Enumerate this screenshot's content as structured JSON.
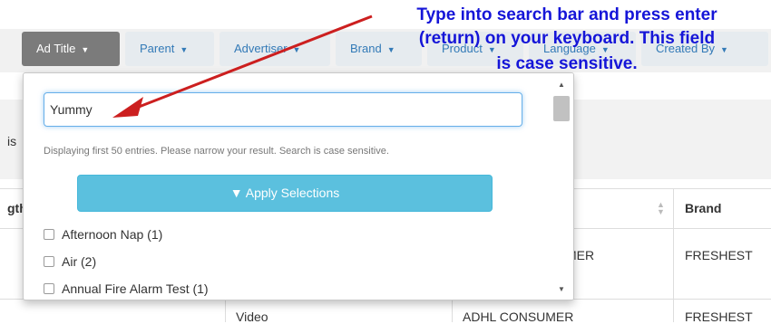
{
  "filters": {
    "ad_title": "Ad Title",
    "parent": "Parent",
    "advertiser": "Advertiser",
    "brand": "Brand",
    "product": "Product",
    "language": "Language",
    "created_by": "Created By"
  },
  "table": {
    "partial_header_1": "is",
    "partial_header_2": "gth",
    "brand_header": "Brand",
    "row1": {
      "company": "MER",
      "brand": "FRESHEST"
    },
    "row2": {
      "type": "Video",
      "company": "ADHL CONSUMER",
      "brand": "FRESHEST"
    }
  },
  "dropdown": {
    "search_value": "Yummy",
    "hint": "Displaying first 50 entries. Please narrow your result. Search is case sensitive.",
    "apply_label": "Apply Selections",
    "options": [
      "Afternoon Nap (1)",
      "Air (2)",
      "Annual Fire Alarm Test (1)"
    ]
  },
  "annotation": {
    "line1": "Type into search bar and press enter",
    "line2": "(return) on your keyboard. This field",
    "line3": "is case sensitive."
  },
  "colors": {
    "annotation": "#1515d8",
    "arrow": "#cc1f1f",
    "apply_button": "#5bc0de"
  }
}
